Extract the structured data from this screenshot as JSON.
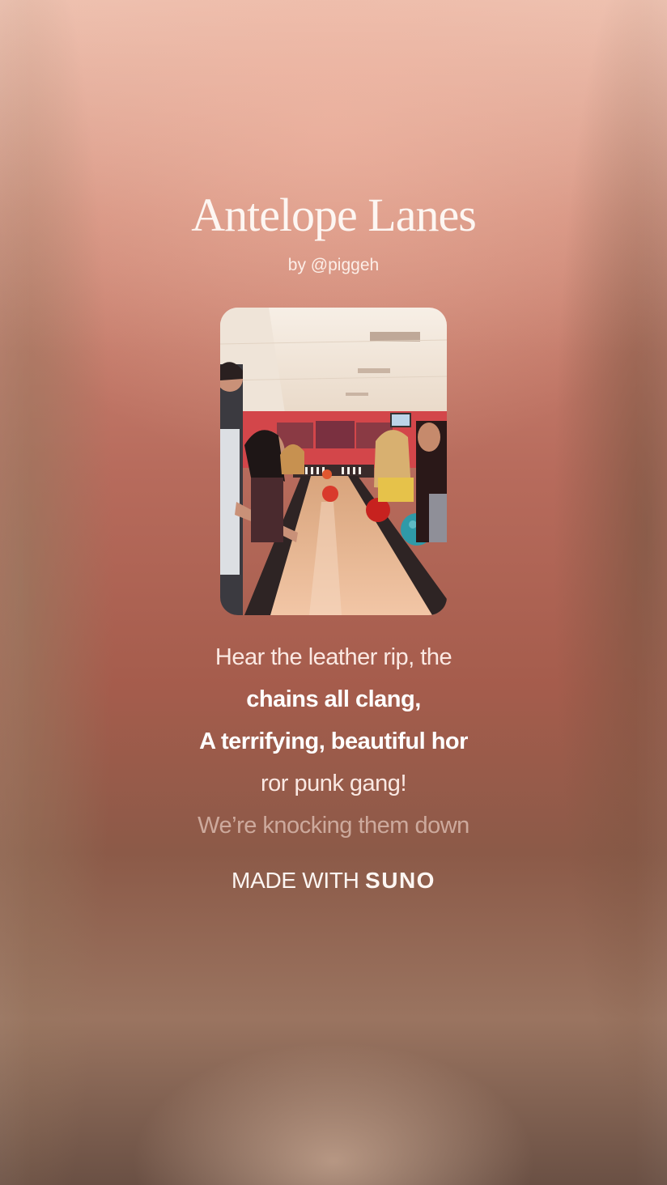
{
  "song": {
    "title": "Antelope Lanes",
    "byline": "by @piggeh"
  },
  "cover_art": {
    "description_icon": "bowling-alley-photo"
  },
  "lyrics": {
    "lines": [
      "Hear the leather rip, the",
      "chains all clang,",
      "A terrifying, beautiful hor",
      "ror punk gang!",
      "We’re knocking them down"
    ]
  },
  "footer": {
    "made_with": "MADE WITH",
    "brand": "SUNO"
  },
  "colors": {
    "background_top": "#e8b6a4",
    "background_mid": "#b76b5c",
    "background_bottom": "#6a5044",
    "text": "#ffffff"
  }
}
